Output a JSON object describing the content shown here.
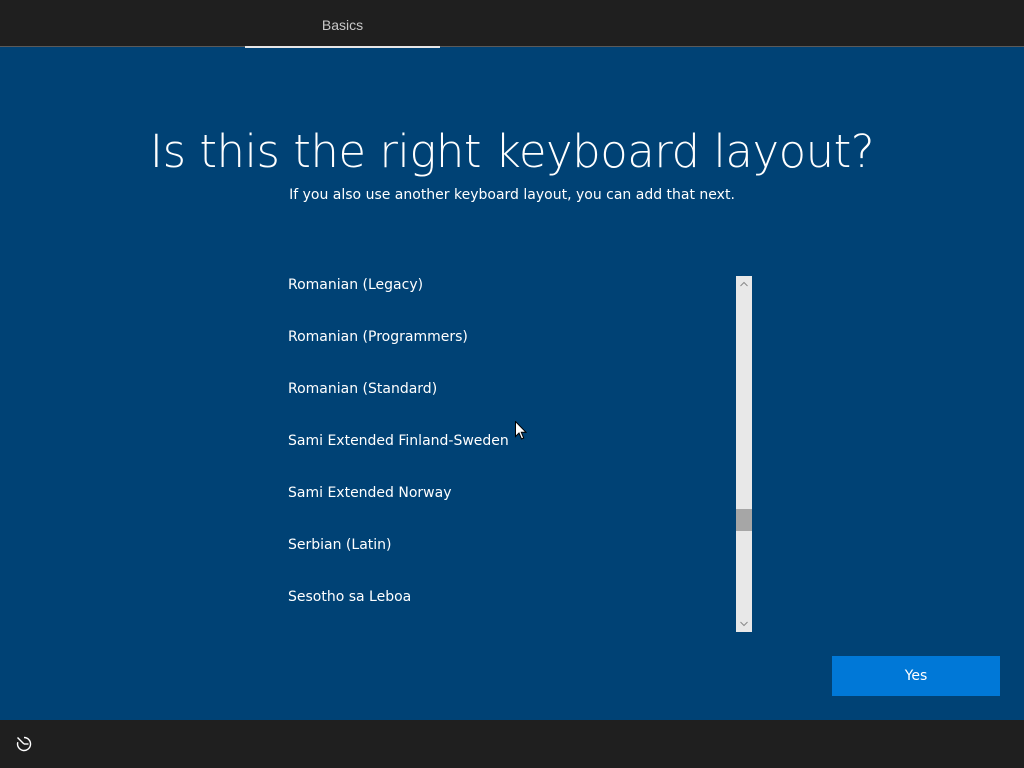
{
  "header": {
    "tab_label": "Basics"
  },
  "main": {
    "title": "Is this the right keyboard layout?",
    "subtitle": "If you also use another keyboard layout, you can add that next.",
    "layouts": [
      "Romanian (Legacy)",
      "Romanian (Programmers)",
      "Romanian (Standard)",
      "Sami Extended Finland-Sweden",
      "Sami Extended Norway",
      "Serbian (Latin)",
      "Sesotho sa Leboa"
    ],
    "yes_label": "Yes"
  },
  "scrollbar": {
    "position_fraction": 0.72
  },
  "footer": {
    "ease_of_access_icon": "ease-of-access-icon"
  },
  "colors": {
    "background": "#004275",
    "bar": "#1f1f1f",
    "accent": "#0078d7"
  }
}
